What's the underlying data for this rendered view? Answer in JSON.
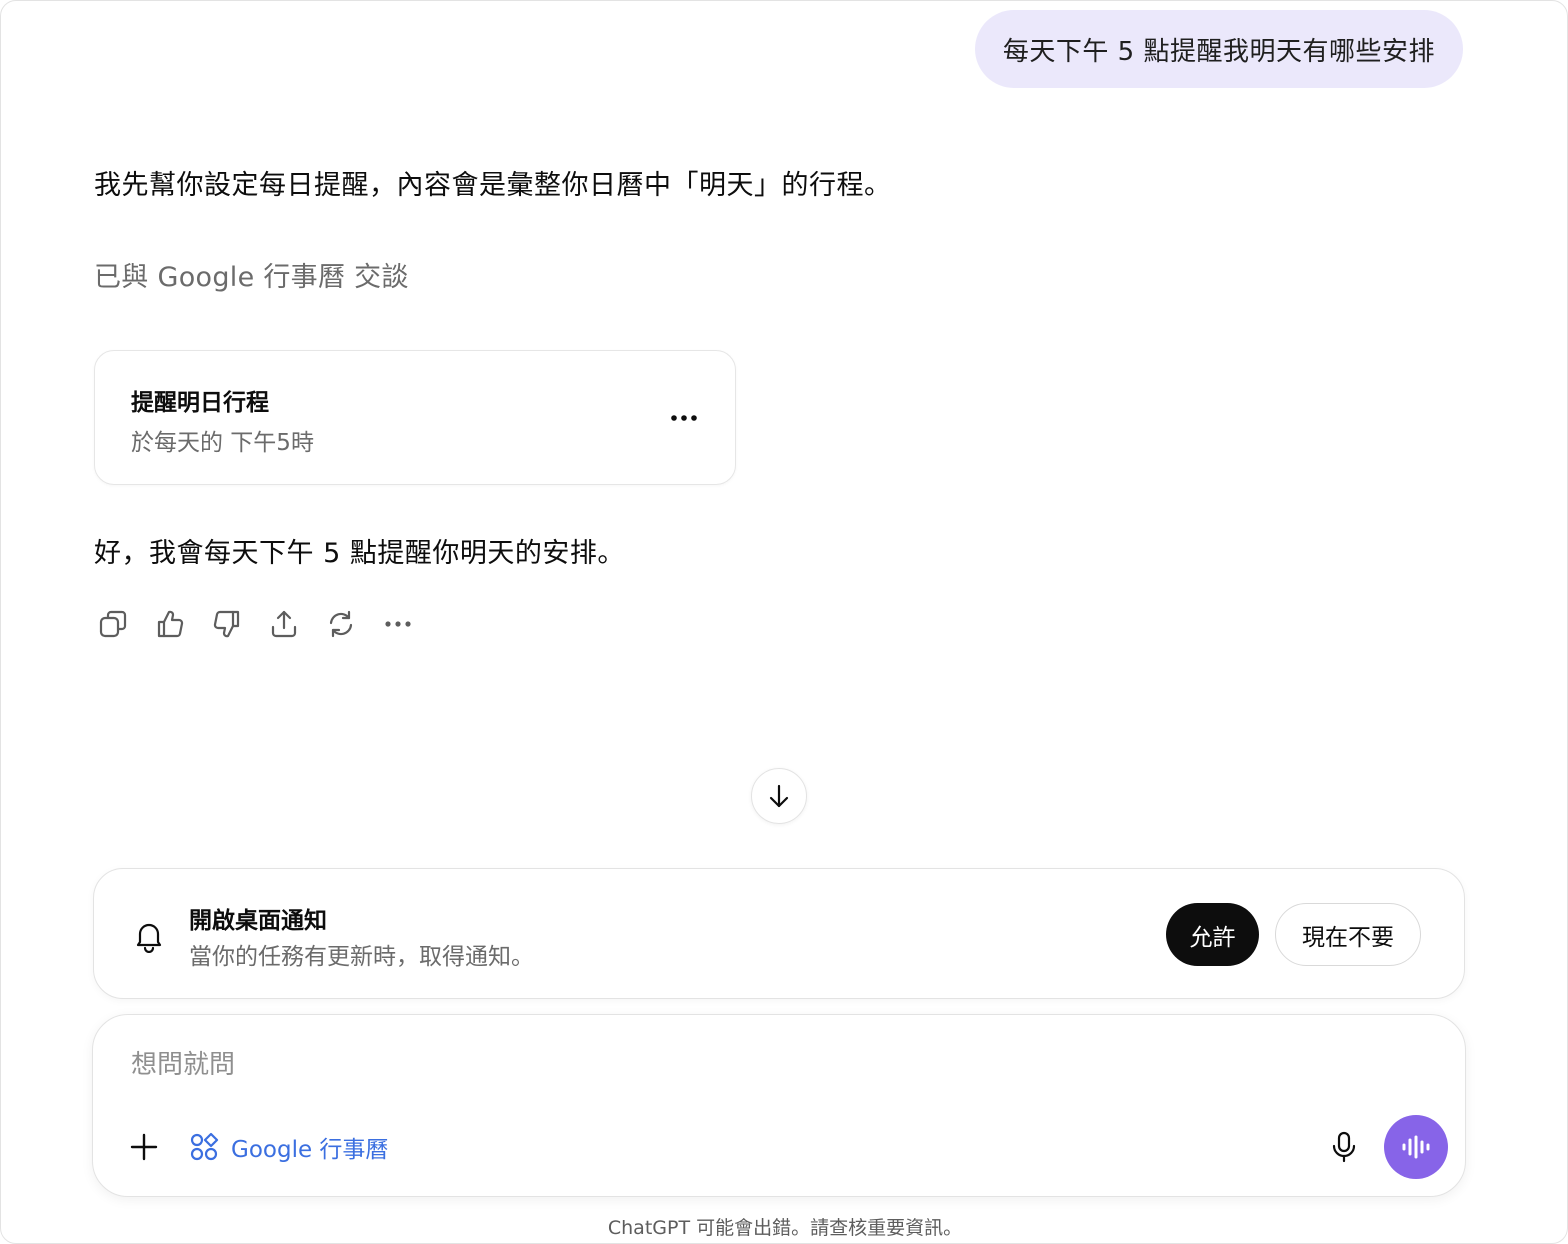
{
  "conversation": {
    "user_message": "每天下午 5 點提醒我明天有哪些安排",
    "assistant_intro": "我先幫你設定每日提醒，內容會是彙整你日曆中「明天」的行程。",
    "tool_status": "已與 Google 行事曆 交談",
    "reminder_card": {
      "title": "提醒明日行程",
      "schedule": "於每天的 下午5時"
    },
    "assistant_reply": "好，我會每天下午 5 點提醒你明天的安排。",
    "actions": [
      "copy-icon",
      "thumbs-up-icon",
      "thumbs-down-icon",
      "share-icon",
      "regenerate-icon",
      "more-icon"
    ]
  },
  "notification_prompt": {
    "title": "開啟桌面通知",
    "description": "當你的任務有更新時，取得通知。",
    "allow_label": "允許",
    "not_now_label": "現在不要"
  },
  "composer": {
    "placeholder": "想問就問",
    "tool_chip_label": "Google 行事曆"
  },
  "footer": {
    "disclaimer": "ChatGPT 可能會出錯。請查核重要資訊。"
  },
  "colors": {
    "user_bubble": "#ebe8fb",
    "allow_button": "#0d0d0d",
    "voice_button": "#8764e8",
    "tool_chip": "#3b6fe0"
  }
}
